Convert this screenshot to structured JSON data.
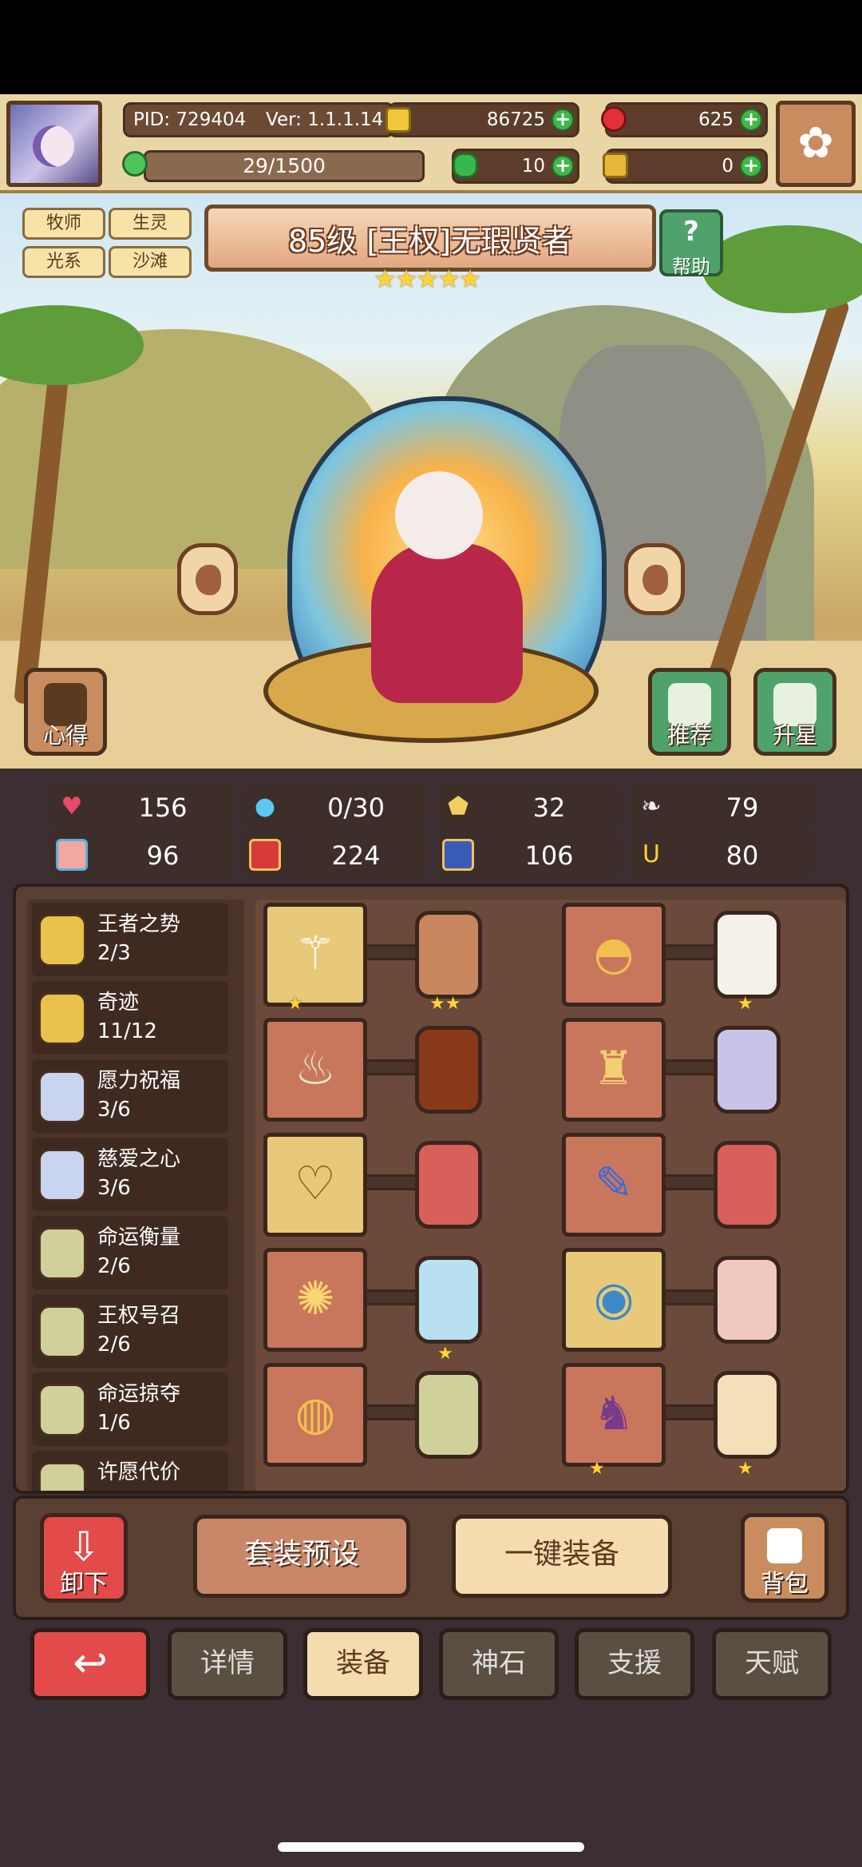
{
  "header": {
    "pid": "PID: 729404",
    "version": "Ver: 1.1.1.14",
    "gold": "86725",
    "gems": "625",
    "stamina": "29/1500",
    "clover": "10",
    "key": "0"
  },
  "tags": [
    "牧师",
    "生灵",
    "光系",
    "沙滩"
  ],
  "hero": {
    "title": "85级 [王权]无瑕贤者",
    "stars": "★★★★★",
    "help_label": "帮助",
    "insight_label": "心得",
    "recommend_label": "推荐",
    "star_up_label": "升星"
  },
  "stats": [
    {
      "icon": "heart-icon",
      "value": "156"
    },
    {
      "icon": "water-drop-icon",
      "value": "0/30"
    },
    {
      "icon": "shield-icon",
      "value": "32"
    },
    {
      "icon": "wing-icon",
      "value": "79"
    },
    {
      "icon": "fist-icon",
      "value": "96"
    },
    {
      "icon": "book-icon",
      "value": "224"
    },
    {
      "icon": "boot-icon",
      "value": "106"
    },
    {
      "icon": "horseshoe-icon",
      "value": "80"
    }
  ],
  "sets": [
    {
      "name": "王者之势",
      "count": "2/3"
    },
    {
      "name": "奇迹",
      "count": "11/12"
    },
    {
      "name": "愿力祝福",
      "count": "3/6"
    },
    {
      "name": "慈爱之心",
      "count": "3/6"
    },
    {
      "name": "命运衡量",
      "count": "2/6"
    },
    {
      "name": "王权号召",
      "count": "2/6"
    },
    {
      "name": "命运掠夺",
      "count": "1/6"
    },
    {
      "name": "许愿代价",
      "count": ""
    }
  ],
  "equipment": {
    "slot_stars": [
      "★",
      "★★",
      "★",
      "★",
      "★",
      "★"
    ]
  },
  "actions": {
    "unequip_label": "卸下",
    "preset_label": "套装预设",
    "auto_equip_label": "一键装备",
    "bag_label": "背包"
  },
  "tabs": {
    "details": "详情",
    "equip": "装备",
    "godstone": "神石",
    "support": "支援",
    "talent": "天赋"
  },
  "colors": {
    "accent_red": "#e34a4a",
    "panel_brown": "#5a3f33",
    "gold_frame": "#e8c97a",
    "green_button": "#4fa36a"
  }
}
